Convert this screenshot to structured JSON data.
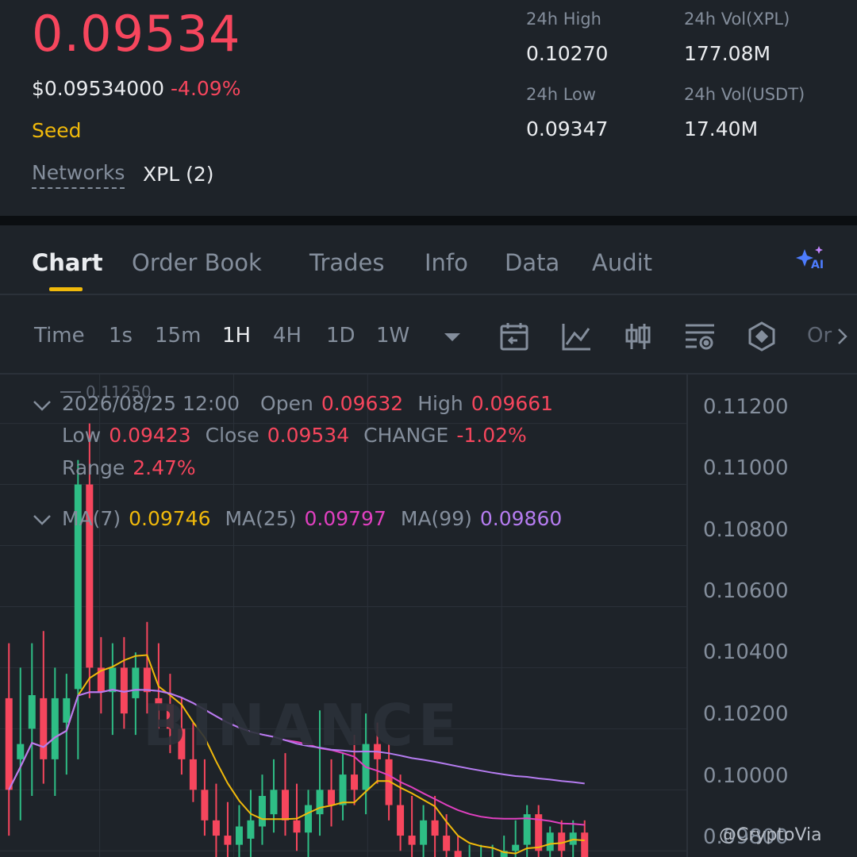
{
  "ticker": {
    "price": "0.09534",
    "price_usd": "$0.09534000",
    "change_pct": "-4.09%",
    "tag": "Seed",
    "networks_label": "Networks",
    "networks_value": "XPL (2)"
  },
  "stats": {
    "high_label": "24h High",
    "high_value": "0.10270",
    "low_label": "24h Low",
    "low_value": "0.09347",
    "vol_xpl_label": "24h Vol(XPL)",
    "vol_xpl_value": "177.08M",
    "vol_usdt_label": "24h Vol(USDT)",
    "vol_usdt_value": "17.40M"
  },
  "tabs": [
    {
      "label": "Chart"
    },
    {
      "label": "Order Book"
    },
    {
      "label": "Trades"
    },
    {
      "label": "Info"
    },
    {
      "label": "Data"
    },
    {
      "label": "Audit"
    }
  ],
  "intervals": [
    {
      "label": "Time"
    },
    {
      "label": "1s"
    },
    {
      "label": "15m"
    },
    {
      "label": "1H"
    },
    {
      "label": "4H"
    },
    {
      "label": "1D"
    },
    {
      "label": "1W"
    }
  ],
  "more_label": "Or",
  "ohlc": {
    "datetime": "2026/08/25 12:00",
    "open_label": "Open",
    "open": "0.09632",
    "high_label": "High",
    "high": "0.09661",
    "low_label": "Low",
    "low": "0.09423",
    "close_label": "Close",
    "close": "0.09534",
    "change_label": "CHANGE",
    "change": "-1.02%",
    "range_label": "Range",
    "range": "2.47%"
  },
  "ma": {
    "ma7_label": "MA(7)",
    "ma7": "0.09746",
    "ma25_label": "MA(25)",
    "ma25": "0.09797",
    "ma99_label": "MA(99)",
    "ma99": "0.09860"
  },
  "top_mark": "0.11250",
  "watermark": "BINANCE",
  "credit": "@CryptoVia",
  "colors": {
    "up": "#2ebd85",
    "down": "#f6465d",
    "ma7": "#f0b90b",
    "ma25": "#e040c0",
    "ma99": "#b57cf0",
    "accent": "#f0b90b"
  },
  "chart_data": {
    "type": "candlestick",
    "y_ticks": [
      "0.11200",
      "0.11000",
      "0.10800",
      "0.10600",
      "0.10400",
      "0.10200",
      "0.10000",
      "0.09800"
    ],
    "ylim": [
      0.0978,
      0.1136
    ],
    "candles": [
      {
        "o": 0.103,
        "h": 0.1048,
        "l": 0.0985,
        "c": 0.1
      },
      {
        "o": 0.101,
        "h": 0.104,
        "l": 0.099,
        "c": 0.1015
      },
      {
        "o": 0.102,
        "h": 0.1048,
        "l": 0.0998,
        "c": 0.1031
      },
      {
        "o": 0.103,
        "h": 0.1052,
        "l": 0.1002,
        "c": 0.101
      },
      {
        "o": 0.101,
        "h": 0.104,
        "l": 0.0998,
        "c": 0.103
      },
      {
        "o": 0.1022,
        "h": 0.1038,
        "l": 0.1005,
        "c": 0.103
      },
      {
        "o": 0.1033,
        "h": 0.1108,
        "l": 0.101,
        "c": 0.11
      },
      {
        "o": 0.11,
        "h": 0.112,
        "l": 0.103,
        "c": 0.104
      },
      {
        "o": 0.104,
        "h": 0.105,
        "l": 0.1025,
        "c": 0.1032
      },
      {
        "o": 0.1032,
        "h": 0.1048,
        "l": 0.1018,
        "c": 0.104
      },
      {
        "o": 0.104,
        "h": 0.105,
        "l": 0.102,
        "c": 0.1025
      },
      {
        "o": 0.103,
        "h": 0.1045,
        "l": 0.1018,
        "c": 0.104
      },
      {
        "o": 0.104,
        "h": 0.1055,
        "l": 0.1025,
        "c": 0.1032
      },
      {
        "o": 0.103,
        "h": 0.1048,
        "l": 0.102,
        "c": 0.1028
      },
      {
        "o": 0.1028,
        "h": 0.1038,
        "l": 0.1012,
        "c": 0.102
      },
      {
        "o": 0.102,
        "h": 0.103,
        "l": 0.1005,
        "c": 0.101
      },
      {
        "o": 0.101,
        "h": 0.1022,
        "l": 0.0996,
        "c": 0.1
      },
      {
        "o": 0.1,
        "h": 0.101,
        "l": 0.0985,
        "c": 0.099
      },
      {
        "o": 0.099,
        "h": 0.1002,
        "l": 0.0978,
        "c": 0.0985
      },
      {
        "o": 0.0985,
        "h": 0.0996,
        "l": 0.0978,
        "c": 0.0982
      },
      {
        "o": 0.0982,
        "h": 0.0995,
        "l": 0.0978,
        "c": 0.0988
      },
      {
        "o": 0.0984,
        "h": 0.1,
        "l": 0.0978,
        "c": 0.099
      },
      {
        "o": 0.0988,
        "h": 0.1005,
        "l": 0.0982,
        "c": 0.0998
      },
      {
        "o": 0.0992,
        "h": 0.101,
        "l": 0.0986,
        "c": 0.1
      },
      {
        "o": 0.1,
        "h": 0.1012,
        "l": 0.0985,
        "c": 0.099
      },
      {
        "o": 0.099,
        "h": 0.1002,
        "l": 0.098,
        "c": 0.0986
      },
      {
        "o": 0.0986,
        "h": 0.1,
        "l": 0.0978,
        "c": 0.0995
      },
      {
        "o": 0.0992,
        "h": 0.1026,
        "l": 0.0985,
        "c": 0.1
      },
      {
        "o": 0.1,
        "h": 0.101,
        "l": 0.0988,
        "c": 0.0995
      },
      {
        "o": 0.0995,
        "h": 0.1012,
        "l": 0.099,
        "c": 0.1005
      },
      {
        "o": 0.1005,
        "h": 0.1018,
        "l": 0.0995,
        "c": 0.1
      },
      {
        "o": 0.1,
        "h": 0.1025,
        "l": 0.0992,
        "c": 0.1015
      },
      {
        "o": 0.1015,
        "h": 0.1022,
        "l": 0.1002,
        "c": 0.101
      },
      {
        "o": 0.101,
        "h": 0.1015,
        "l": 0.099,
        "c": 0.0995
      },
      {
        "o": 0.0995,
        "h": 0.1005,
        "l": 0.098,
        "c": 0.0985
      },
      {
        "o": 0.0985,
        "h": 0.0998,
        "l": 0.0978,
        "c": 0.0982
      },
      {
        "o": 0.0982,
        "h": 0.0995,
        "l": 0.0978,
        "c": 0.099
      },
      {
        "o": 0.099,
        "h": 0.0998,
        "l": 0.0978,
        "c": 0.0985
      },
      {
        "o": 0.0985,
        "h": 0.0992,
        "l": 0.0978,
        "c": 0.098
      },
      {
        "o": 0.098,
        "h": 0.0985,
        "l": 0.0978,
        "c": 0.0978
      },
      {
        "o": 0.0978,
        "h": 0.0982,
        "l": 0.0978,
        "c": 0.0978
      },
      {
        "o": 0.0978,
        "h": 0.0982,
        "l": 0.0978,
        "c": 0.0978
      },
      {
        "o": 0.0978,
        "h": 0.0982,
        "l": 0.0978,
        "c": 0.0978
      },
      {
        "o": 0.0978,
        "h": 0.0985,
        "l": 0.0978,
        "c": 0.098
      },
      {
        "o": 0.098,
        "h": 0.099,
        "l": 0.0978,
        "c": 0.0982
      },
      {
        "o": 0.0982,
        "h": 0.0995,
        "l": 0.0978,
        "c": 0.0992
      },
      {
        "o": 0.0992,
        "h": 0.0995,
        "l": 0.0978,
        "c": 0.098
      },
      {
        "o": 0.098,
        "h": 0.0988,
        "l": 0.0978,
        "c": 0.0986
      },
      {
        "o": 0.0986,
        "h": 0.099,
        "l": 0.0978,
        "c": 0.098
      },
      {
        "o": 0.0982,
        "h": 0.099,
        "l": 0.0978,
        "c": 0.0986
      },
      {
        "o": 0.0986,
        "h": 0.099,
        "l": 0.0978,
        "c": 0.0978
      }
    ]
  }
}
